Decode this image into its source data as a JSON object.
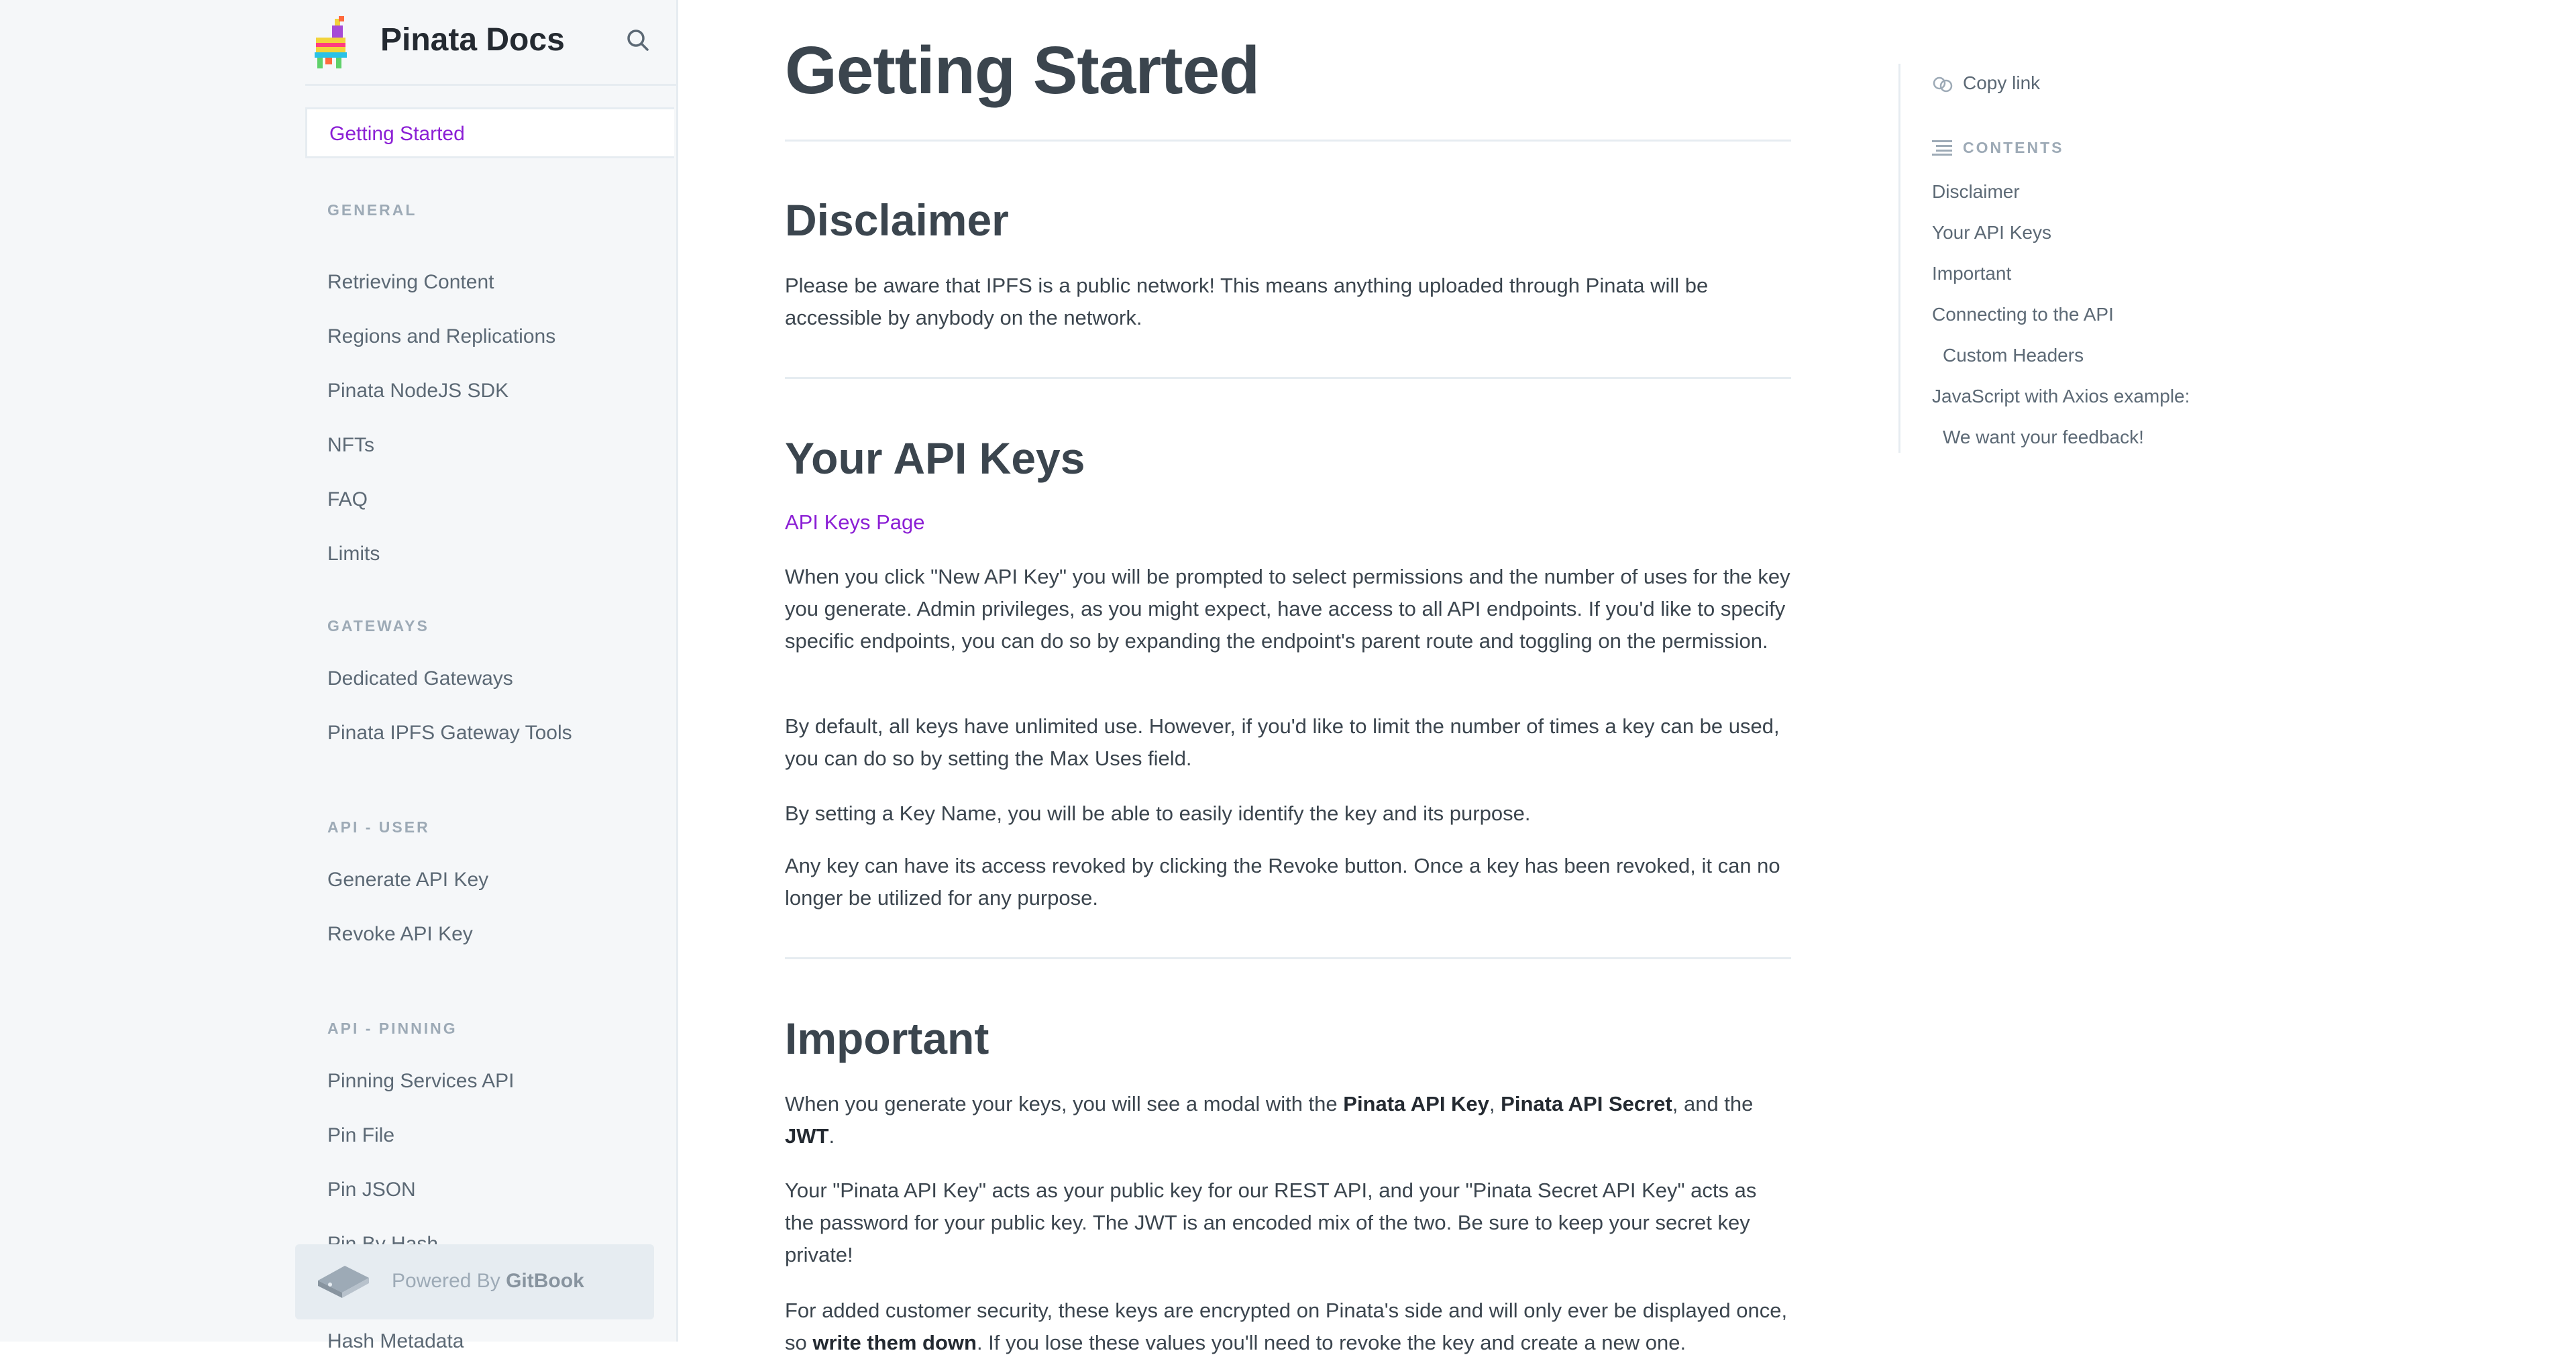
{
  "sidebar": {
    "brand": "Pinata Docs",
    "active_item": "Getting Started",
    "sections": [
      {
        "title": "GENERAL",
        "items": [
          "Retrieving Content",
          "Regions and Replications",
          "Pinata NodeJS SDK",
          "NFTs",
          "FAQ",
          "Limits"
        ]
      },
      {
        "title": "GATEWAYS",
        "items": [
          "Dedicated Gateways",
          "Pinata IPFS Gateway Tools"
        ]
      },
      {
        "title": "API - USER",
        "items": [
          "Generate API Key",
          "Revoke API Key"
        ]
      },
      {
        "title": "API - PINNING",
        "items": [
          "Pinning Services API",
          "Pin File",
          "Pin JSON",
          "Pin By Hash",
          "Hash Metadata"
        ]
      }
    ],
    "powered_by_prefix": "Powered By ",
    "powered_by_brand": "GitBook"
  },
  "main": {
    "title": "Getting Started",
    "disclaimer": {
      "heading": "Disclaimer",
      "text": "Please be aware that IPFS is a public network! This means anything uploaded through Pinata will be accessible by anybody on the network."
    },
    "api_keys": {
      "heading": "Your API Keys",
      "link": "API Keys Page",
      "p1": "When you click \"New API Key\" you will be prompted to select permissions and the number of uses for the key you generate. Admin privileges, as you might expect, have access to all API endpoints. If you'd like to specify specific endpoints, you can do so by expanding the endpoint's parent route and toggling on the permission.",
      "p2": "By default, all keys have unlimited use. However, if you'd like to limit the number of times a key can be used, you can do so by setting the Max Uses field.",
      "p3": "By setting a Key Name, you will be able to easily identify the key and its purpose.",
      "p4": "Any key can have its access revoked by clicking the Revoke button. Once a key has been revoked, it can no longer be utilized for any purpose."
    },
    "important": {
      "heading": "Important",
      "p1_a": "When you generate your keys, you will see a modal with the ",
      "p1_b": "Pinata API Key",
      "p1_c": ", ",
      "p1_d": "Pinata API Secret",
      "p1_e": ", and the ",
      "p1_f": "JWT",
      "p1_g": ".",
      "p2": "Your \"Pinata API Key\" acts as your public key for our REST API, and your \"Pinata Secret API Key\" acts as the password for your public key. The JWT is an encoded mix of the two. Be sure to keep your secret key private!",
      "p3_a": "For added customer security, these keys are encrypted on Pinata's side and will only ever be displayed once, so ",
      "p3_b": "write them down",
      "p3_c": ". If you lose these values you'll need to revoke the key and create a new one."
    }
  },
  "toc": {
    "copy_link": "Copy link",
    "heading": "CONTENTS",
    "items": [
      "Disclaimer",
      "Your API Keys",
      "Important",
      "Connecting to the API",
      "Custom Headers",
      "JavaScript with Axios example:",
      "We want your feedback!"
    ]
  },
  "icons": [
    "pinata-logo-icon",
    "search-icon",
    "gitbook-icon",
    "copy-link-icon",
    "contents-icon"
  ],
  "colors": {
    "accent": "#8b1fd5",
    "text": "#3b454e",
    "sidebar_bg": "#f5f7f9",
    "border": "#e6ecf1"
  }
}
